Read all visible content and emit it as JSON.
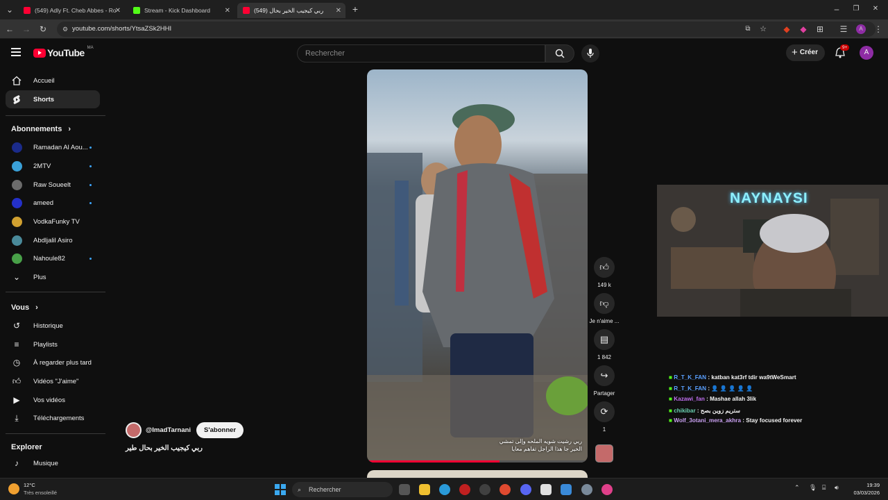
{
  "browser": {
    "tabs": [
      {
        "title": "(549) Adly Ft. Cheb Abbes - Ro",
        "favicon_color": "#ff0033"
      },
      {
        "title": "Stream - Kick Dashboard",
        "favicon_color": "#53fc18"
      },
      {
        "title": "(549) ربي كيجيب الخير بحال",
        "favicon_color": "#ff0033"
      }
    ],
    "url": "youtube.com/shorts/YtsaZSk2HHI",
    "profile_initial": "A"
  },
  "youtube": {
    "logo": "YouTube",
    "country": "MA",
    "search_placeholder": "Rechercher",
    "create_label": "Créer",
    "notif_count": "9+",
    "avatar_initial": "A"
  },
  "sidebar": {
    "main": [
      {
        "label": "Accueil",
        "icon": "home-icon"
      },
      {
        "label": "Shorts",
        "icon": "shorts-icon"
      }
    ],
    "subscriptions_header": "Abonnements",
    "subscriptions": [
      {
        "label": "Ramadan Al Aou...",
        "color": "#1b2b8a",
        "dot": true
      },
      {
        "label": "2MTV",
        "color": "#3aa0d8",
        "dot": true
      },
      {
        "label": "Raw Soueelt",
        "color": "#6b6b6b",
        "dot": true
      },
      {
        "label": "ameed",
        "color": "#2430c8",
        "dot": true
      },
      {
        "label": "VodkaFunky TV",
        "color": "#d0a030",
        "dot": false
      },
      {
        "label": "Abdljalil Asiro",
        "color": "#4a8a9a",
        "dot": false
      },
      {
        "label": "Nahoule82",
        "color": "#48a048",
        "dot": true
      }
    ],
    "more_label": "Plus",
    "you_header": "Vous",
    "you_items": [
      {
        "label": "Historique",
        "icon": "history-icon"
      },
      {
        "label": "Playlists",
        "icon": "playlist-icon"
      },
      {
        "label": "À regarder plus tard",
        "icon": "clock-icon"
      },
      {
        "label": "Vidéos \"J'aime\"",
        "icon": "thumb-up-icon"
      },
      {
        "label": "Vos vidéos",
        "icon": "video-icon"
      },
      {
        "label": "Téléchargements",
        "icon": "download-icon"
      }
    ],
    "explore_header": "Explorer",
    "explore_items": [
      {
        "label": "Musique",
        "icon": "music-icon"
      }
    ]
  },
  "short": {
    "channel": "@ImadTarnani",
    "subscribe_label": "S'abonner",
    "title": "ربي كيجيب الخير  بحال طير",
    "caption_line1": "ربي رشيت شويه الملحه وإلى تمشي",
    "caption_line2": "الخير جا هذا الراجل تفاهم معايا",
    "progress_fraction": 0.6,
    "likes": "149 k",
    "dislike_label": "Je n'aime ...",
    "comments": "1 842",
    "share_label": "Partager",
    "remix_count": "1"
  },
  "stream": {
    "webcam_title": "NAYNAYSI",
    "chat": [
      {
        "user": "R_T_K_FAN",
        "user_color": "#5aa0ff",
        "message": "katban kat3rf tdir wa9tWeSmart"
      },
      {
        "user": "R_T_K_FAN",
        "user_color": "#5aa0ff",
        "message": "👤 👤 👤 👤 👤"
      },
      {
        "user": "Kazawi_fan",
        "user_color": "#c070f0",
        "message": "Mashae allah 3lik"
      },
      {
        "user": "chikibar",
        "user_color": "#6ad0b0",
        "message": "ستريم زوين بصح"
      },
      {
        "user": "Wolf_3otani_mera_akhra",
        "user_color": "#c8a0f0",
        "message": "Stay focused forever"
      }
    ]
  },
  "taskbar": {
    "weather_temp": "12°C",
    "weather_desc": "Très ensoleillé",
    "search_placeholder": "Rechercher",
    "time": "19:39",
    "date": "03/03/2026"
  }
}
